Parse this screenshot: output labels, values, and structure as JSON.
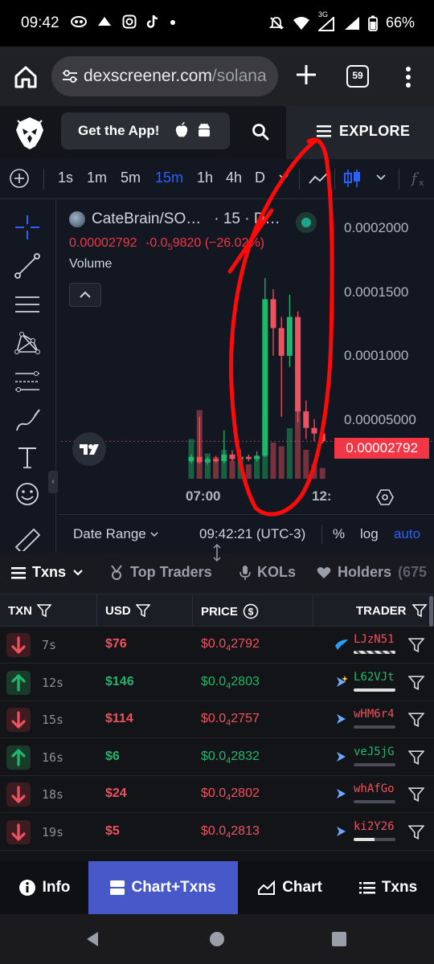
{
  "status_bar": {
    "time": "09:42",
    "network": "3G",
    "battery": "66%",
    "notification_icons": [
      "voicemail-icon",
      "pizza-icon",
      "instagram-icon",
      "tiktok-icon",
      "dot-icon"
    ]
  },
  "browser": {
    "url_host": "dexscreener.com",
    "url_path": "/solana",
    "tab_count": "59"
  },
  "header": {
    "get_app_label": "Get the App!",
    "explore_label": "EXPLORE"
  },
  "chart_toolbar": {
    "timeframes": [
      "1s",
      "1m",
      "5m",
      "15m",
      "1h",
      "4h",
      "D"
    ],
    "active_timeframe": "15m"
  },
  "chart": {
    "symbol": "CateBrain/SO…",
    "interval": "· 15 · D…",
    "last_price": "0.00002792",
    "change": "-0.0",
    "change_sub": "5",
    "change_rest": "9820 (−26.02%)",
    "volume_label": "Volume",
    "time_labels": [
      "07:00",
      "12:"
    ],
    "date_range_label": "Date Range",
    "clock": "09:42:21 (UTC-3)",
    "pct_label": "%",
    "log_label": "log",
    "auto_label": "auto"
  },
  "chart_data": {
    "type": "candlestick",
    "title": "CateBrain/SOL",
    "ylim": [
      0,
      0.00022
    ],
    "y_ticks": [
      "0.0002000",
      "0.0001500",
      "0.0001000",
      "0.00005000"
    ],
    "x_ticks": [
      "07:00",
      "12:"
    ],
    "candles": [
      {
        "o": 1e-05,
        "c": 1.4e-05,
        "h": 1.6e-05,
        "l": 8e-06,
        "v": 0.55
      },
      {
        "o": 1.4e-05,
        "c": 9e-06,
        "h": 5e-05,
        "l": 8e-06,
        "v": 0.95
      },
      {
        "o": 9e-06,
        "c": 1.2e-05,
        "h": 1.4e-05,
        "l": 7e-06,
        "v": 0.35
      },
      {
        "o": 1.2e-05,
        "c": 1e-05,
        "h": 1.5e-05,
        "l": 9e-06,
        "v": 0.3
      },
      {
        "o": 1e-05,
        "c": 1.6e-05,
        "h": 3.8e-05,
        "l": 8e-06,
        "v": 0.4
      },
      {
        "o": 1.6e-05,
        "c": 1.2e-05,
        "h": 2e-05,
        "l": 1e-05,
        "v": 0.25
      },
      {
        "o": 1.2e-05,
        "c": 1.4e-05,
        "h": 2e-05,
        "l": 1e-05,
        "v": 0.3
      },
      {
        "o": 1.4e-05,
        "c": 1.2e-05,
        "h": 1.6e-05,
        "l": 1e-05,
        "v": 0.2
      },
      {
        "o": 1.2e-05,
        "c": 1.5e-05,
        "h": 1.9e-05,
        "l": 1e-05,
        "v": 0.3
      },
      {
        "o": 1.5e-05,
        "c": 0.000156,
        "h": 0.000175,
        "l": 1.4e-05,
        "v": 0.85
      },
      {
        "o": 0.000156,
        "c": 0.00013,
        "h": 0.000165,
        "l": 0.000105,
        "v": 0.5
      },
      {
        "o": 0.00013,
        "c": 0.000105,
        "h": 0.00014,
        "l": 5e-05,
        "v": 0.45
      },
      {
        "o": 0.000105,
        "c": 0.00014,
        "h": 0.00016,
        "l": 9.5e-05,
        "v": 0.7
      },
      {
        "o": 0.00014,
        "c": 5.5e-05,
        "h": 0.000145,
        "l": 4.5e-05,
        "v": 1.0
      },
      {
        "o": 5.5e-05,
        "c": 4e-05,
        "h": 6.5e-05,
        "l": 3e-05,
        "v": 0.4
      },
      {
        "o": 4e-05,
        "c": 3.5e-05,
        "h": 4.8e-05,
        "l": 2.8e-05,
        "v": 0.2
      },
      {
        "o": 3.5e-05,
        "c": 2.8e-05,
        "h": 4e-05,
        "l": 2.6e-05,
        "v": 0.15
      }
    ]
  },
  "tabs": {
    "txns": "Txns",
    "top_traders": "Top Traders",
    "kols": "KOLs",
    "holders": "Holders",
    "holders_count": "(675"
  },
  "table": {
    "headers": {
      "txn": "TXN",
      "usd": "USD",
      "price": "PRICE",
      "trader": "TRADER"
    },
    "rows": [
      {
        "type": "sell",
        "age": "7s",
        "usd": "$76",
        "price_prefix": "$0.0",
        "price_sub": "4",
        "price_rest": "2792",
        "trader": "LJzN51",
        "trader_icon": "bird-icon",
        "bar": 1.0,
        "striped": true
      },
      {
        "type": "buy",
        "age": "12s",
        "usd": "$146",
        "price_prefix": "$0.0",
        "price_sub": "4",
        "price_rest": "2803",
        "trader": "L62VJt",
        "trader_icon": "sparkle-icon",
        "bar": 1.0,
        "striped": false
      },
      {
        "type": "sell",
        "age": "15s",
        "usd": "$114",
        "price_prefix": "$0.0",
        "price_sub": "4",
        "price_rest": "2757",
        "trader": "wHM6r4",
        "trader_icon": "dolphin-icon",
        "bar": 0.0,
        "striped": false
      },
      {
        "type": "buy",
        "age": "16s",
        "usd": "$6",
        "price_prefix": "$0.0",
        "price_sub": "4",
        "price_rest": "2832",
        "trader": "veJ5jG",
        "trader_icon": "dolphin-icon",
        "bar": 0.0,
        "striped": false
      },
      {
        "type": "sell",
        "age": "18s",
        "usd": "$24",
        "price_prefix": "$0.0",
        "price_sub": "4",
        "price_rest": "2802",
        "trader": "whAfGo",
        "trader_icon": "dolphin-icon",
        "bar": 0.0,
        "striped": false
      },
      {
        "type": "sell",
        "age": "19s",
        "usd": "$5",
        "price_prefix": "$0.0",
        "price_sub": "4",
        "price_rest": "2813",
        "trader": "ki2Y26",
        "trader_icon": "dolphin-icon",
        "bar": 0.5,
        "striped": false
      }
    ]
  },
  "bottom_nav": {
    "info": "Info",
    "chart_txns": "Chart+Txns",
    "chart": "Chart",
    "txns": "Txns"
  },
  "colors": {
    "buy": "#1fb86a",
    "sell": "#f0515f",
    "accent": "#2962ff",
    "active_tab": "#4759c8",
    "annotation": "#ff0000"
  }
}
